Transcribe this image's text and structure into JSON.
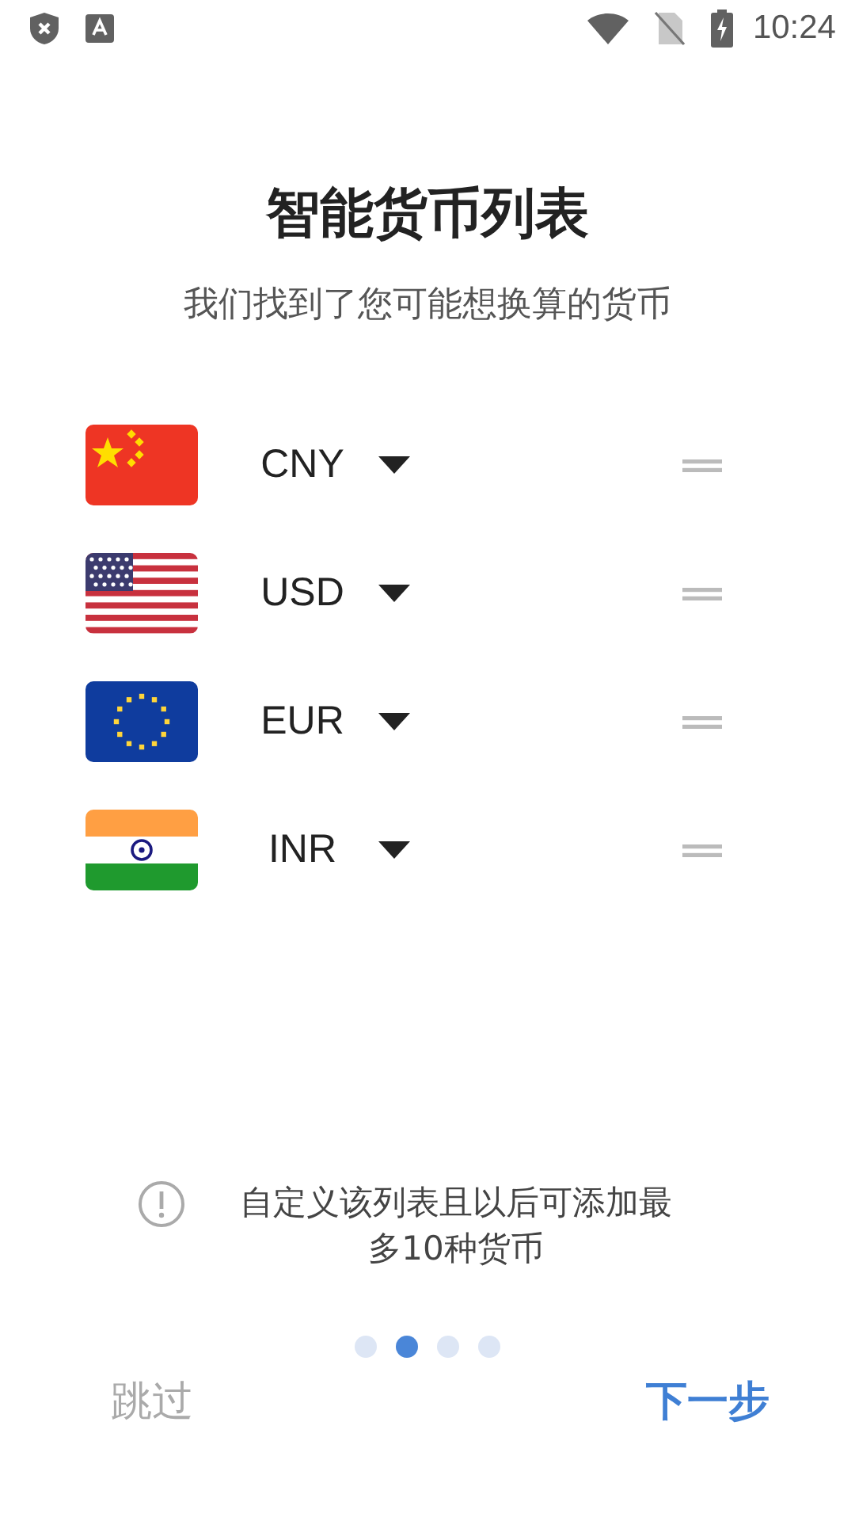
{
  "status_bar": {
    "time": "10:24"
  },
  "title": "智能货币列表",
  "subtitle": "我们找到了您可能想换算的货币",
  "currencies": [
    {
      "code": "CNY",
      "kind": "cn"
    },
    {
      "code": "USD",
      "kind": "us"
    },
    {
      "code": "EUR",
      "kind": "eu"
    },
    {
      "code": "INR",
      "kind": "in"
    }
  ],
  "note": "自定义该列表且以后可添加最多10种货币",
  "pages": [
    {
      "selected": false
    },
    {
      "selected": true
    },
    {
      "selected": false
    },
    {
      "selected": false
    }
  ],
  "skip_button": "跳过",
  "next_button": "下一步"
}
